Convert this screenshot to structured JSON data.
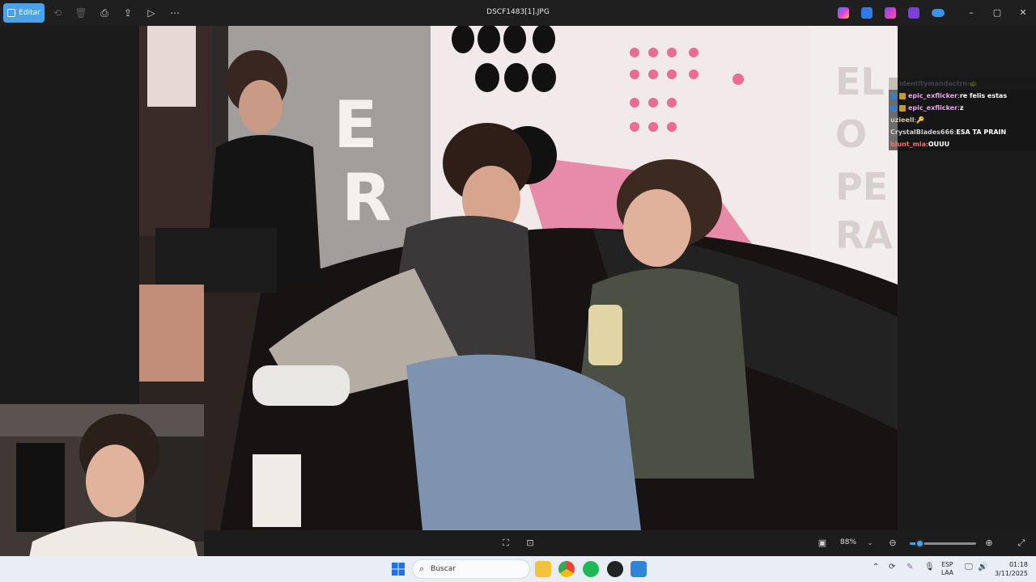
{
  "titlebar": {
    "edit_label": "Editar",
    "file_name": "DSCF1483[1].JPG",
    "actions": [
      "rotate-icon",
      "delete-icon",
      "print-icon",
      "share-icon",
      "slideshow-icon",
      "more-icon"
    ]
  },
  "chat": {
    "lines": [
      {
        "user": "identitymandoctrn",
        "sep": " : ",
        "message": "🐢",
        "user_color": "#7a8fb0",
        "faded": true
      },
      {
        "user": "epic_exflicker",
        "sep": " : ",
        "message": "re felis estas",
        "user_color": "#e7a4f0",
        "faded": false
      },
      {
        "user": "epic_exflicker",
        "sep": " : ",
        "message": "z",
        "user_color": "#e7a4f0",
        "faded": false
      },
      {
        "user": "uzieell",
        "sep": " : ",
        "message": "🔑",
        "user_color": "#d8c7a8",
        "faded": false
      },
      {
        "user": "CrystalBlades666",
        "sep": " : ",
        "message": "ESA TA PRAIN",
        "user_color": "#d0d0d0",
        "faded": false
      },
      {
        "user": "blunt_mia",
        "sep": " : ",
        "message": "OUUU",
        "user_color": "#ff6b6b",
        "faded": false
      }
    ]
  },
  "viewer": {
    "zoom": "88%",
    "zoom_fraction": 0.15
  },
  "taskbar": {
    "search_placeholder": "Buscar",
    "lang_line1": "ESP",
    "lang_line2": "LAA",
    "time": "01:18",
    "date": "3/11/2025"
  },
  "colors": {
    "accent": "#4aa3e8",
    "background": "#1b1b1b"
  }
}
